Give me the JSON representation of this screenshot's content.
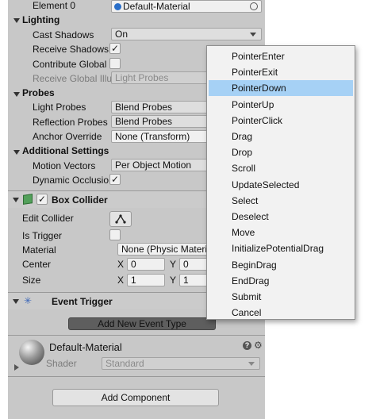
{
  "top_row": {
    "label": "Element 0",
    "value": "Default-Material"
  },
  "lighting": {
    "header": "Lighting",
    "cast_shadows": {
      "label": "Cast Shadows",
      "value": "On"
    },
    "receive_shadows": {
      "label": "Receive Shadows",
      "checked": "✓"
    },
    "contribute_gi": {
      "label": "Contribute Global I"
    },
    "receive_gi": {
      "label": "Receive Global Illu",
      "value": "Light Probes"
    }
  },
  "probes": {
    "header": "Probes",
    "light_probes": {
      "label": "Light Probes",
      "value": "Blend Probes"
    },
    "reflection_probes": {
      "label": "Reflection Probes",
      "value": "Blend Probes"
    },
    "anchor_override": {
      "label": "Anchor Override",
      "value": "None (Transform)"
    }
  },
  "additional": {
    "header": "Additional Settings",
    "motion_vectors": {
      "label": "Motion Vectors",
      "value": "Per Object Motion"
    },
    "dynamic_occlusion": {
      "label": "Dynamic Occlusio",
      "checked": "✓"
    }
  },
  "box_collider": {
    "title": "Box Collider",
    "enabled_check": "✓",
    "edit_collider": "Edit Collider",
    "is_trigger": "Is Trigger",
    "material": {
      "label": "Material",
      "value": "None (Physic Material)"
    },
    "center": {
      "label": "Center",
      "x_label": "X",
      "x": "0",
      "y_label": "Y",
      "y": "0"
    },
    "size": {
      "label": "Size",
      "x_label": "X",
      "x": "1",
      "y_label": "Y",
      "y": "1"
    }
  },
  "event_trigger": {
    "title": "Event Trigger",
    "add_button": "Add New Event Type"
  },
  "material_section": {
    "name": "Default-Material",
    "shader_label": "Shader",
    "shader_value": "Standard"
  },
  "add_component": "Add Component",
  "dropdown": {
    "items": [
      "PointerEnter",
      "PointerExit",
      "PointerDown",
      "PointerUp",
      "PointerClick",
      "Drag",
      "Drop",
      "Scroll",
      "UpdateSelected",
      "Select",
      "Deselect",
      "Move",
      "InitializePotentialDrag",
      "BeginDrag",
      "EndDrag",
      "Submit",
      "Cancel"
    ],
    "highlighted": "PointerDown"
  },
  "colors": {
    "panel_bg": "#c8c8c8",
    "menu_bg": "#f2f2f2",
    "menu_highlight": "#a6d1f5"
  }
}
